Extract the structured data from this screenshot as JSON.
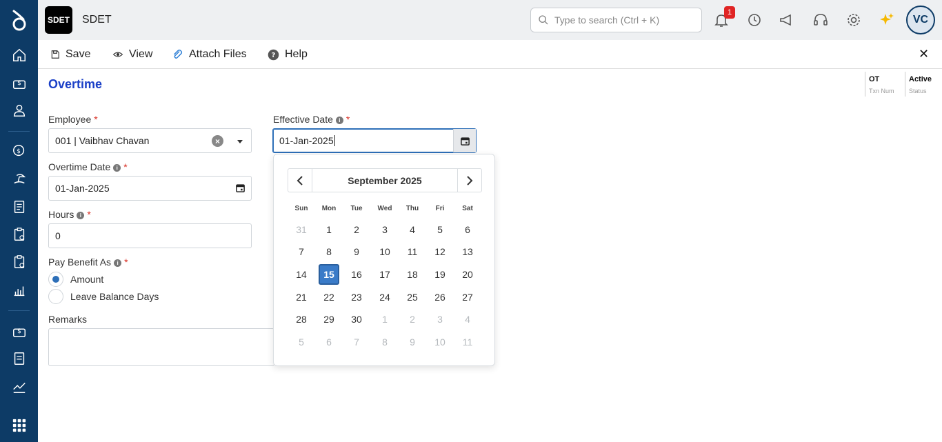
{
  "app": {
    "badge": "SDET",
    "name": "SDET"
  },
  "search": {
    "placeholder": "Type to search (Ctrl + K)"
  },
  "notifications": {
    "count": "1"
  },
  "user": {
    "initials": "VC"
  },
  "toolbar": {
    "save": "Save",
    "view": "View",
    "attach": "Attach Files",
    "help": "Help",
    "close": "✕"
  },
  "page": {
    "title": "Overtime"
  },
  "meta": [
    {
      "value": "OT",
      "label": "Txn Num"
    },
    {
      "value": "Active",
      "label": "Status"
    }
  ],
  "form": {
    "employee_label": "Employee",
    "employee_value": "001 | Vaibhav Chavan",
    "effective_label": "Effective Date",
    "effective_value": "01-Jan-2025",
    "ot_date_label": "Overtime Date",
    "ot_date_value": "01-Jan-2025",
    "hours_label": "Hours",
    "hours_value": "0",
    "pay_label": "Pay Benefit As",
    "opt_amount": "Amount",
    "opt_leave": "Leave Balance Days",
    "remarks_label": "Remarks",
    "required": "*"
  },
  "picker": {
    "month": "September 2025",
    "dow": [
      "Sun",
      "Mon",
      "Tue",
      "Wed",
      "Thu",
      "Fri",
      "Sat"
    ],
    "weeks": [
      [
        "31",
        "1",
        "2",
        "3",
        "4",
        "5",
        "6"
      ],
      [
        "7",
        "8",
        "9",
        "10",
        "11",
        "12",
        "13"
      ],
      [
        "14",
        "15",
        "16",
        "17",
        "18",
        "19",
        "20"
      ],
      [
        "21",
        "22",
        "23",
        "24",
        "25",
        "26",
        "27"
      ],
      [
        "28",
        "29",
        "30",
        "1",
        "2",
        "3",
        "4"
      ],
      [
        "5",
        "6",
        "7",
        "8",
        "9",
        "10",
        "11"
      ]
    ],
    "selected": "15"
  },
  "colors": {
    "sidebar": "#0d3b66",
    "accent": "#2d6fb8",
    "title": "#1a3fc7",
    "badge": "#e02424"
  }
}
